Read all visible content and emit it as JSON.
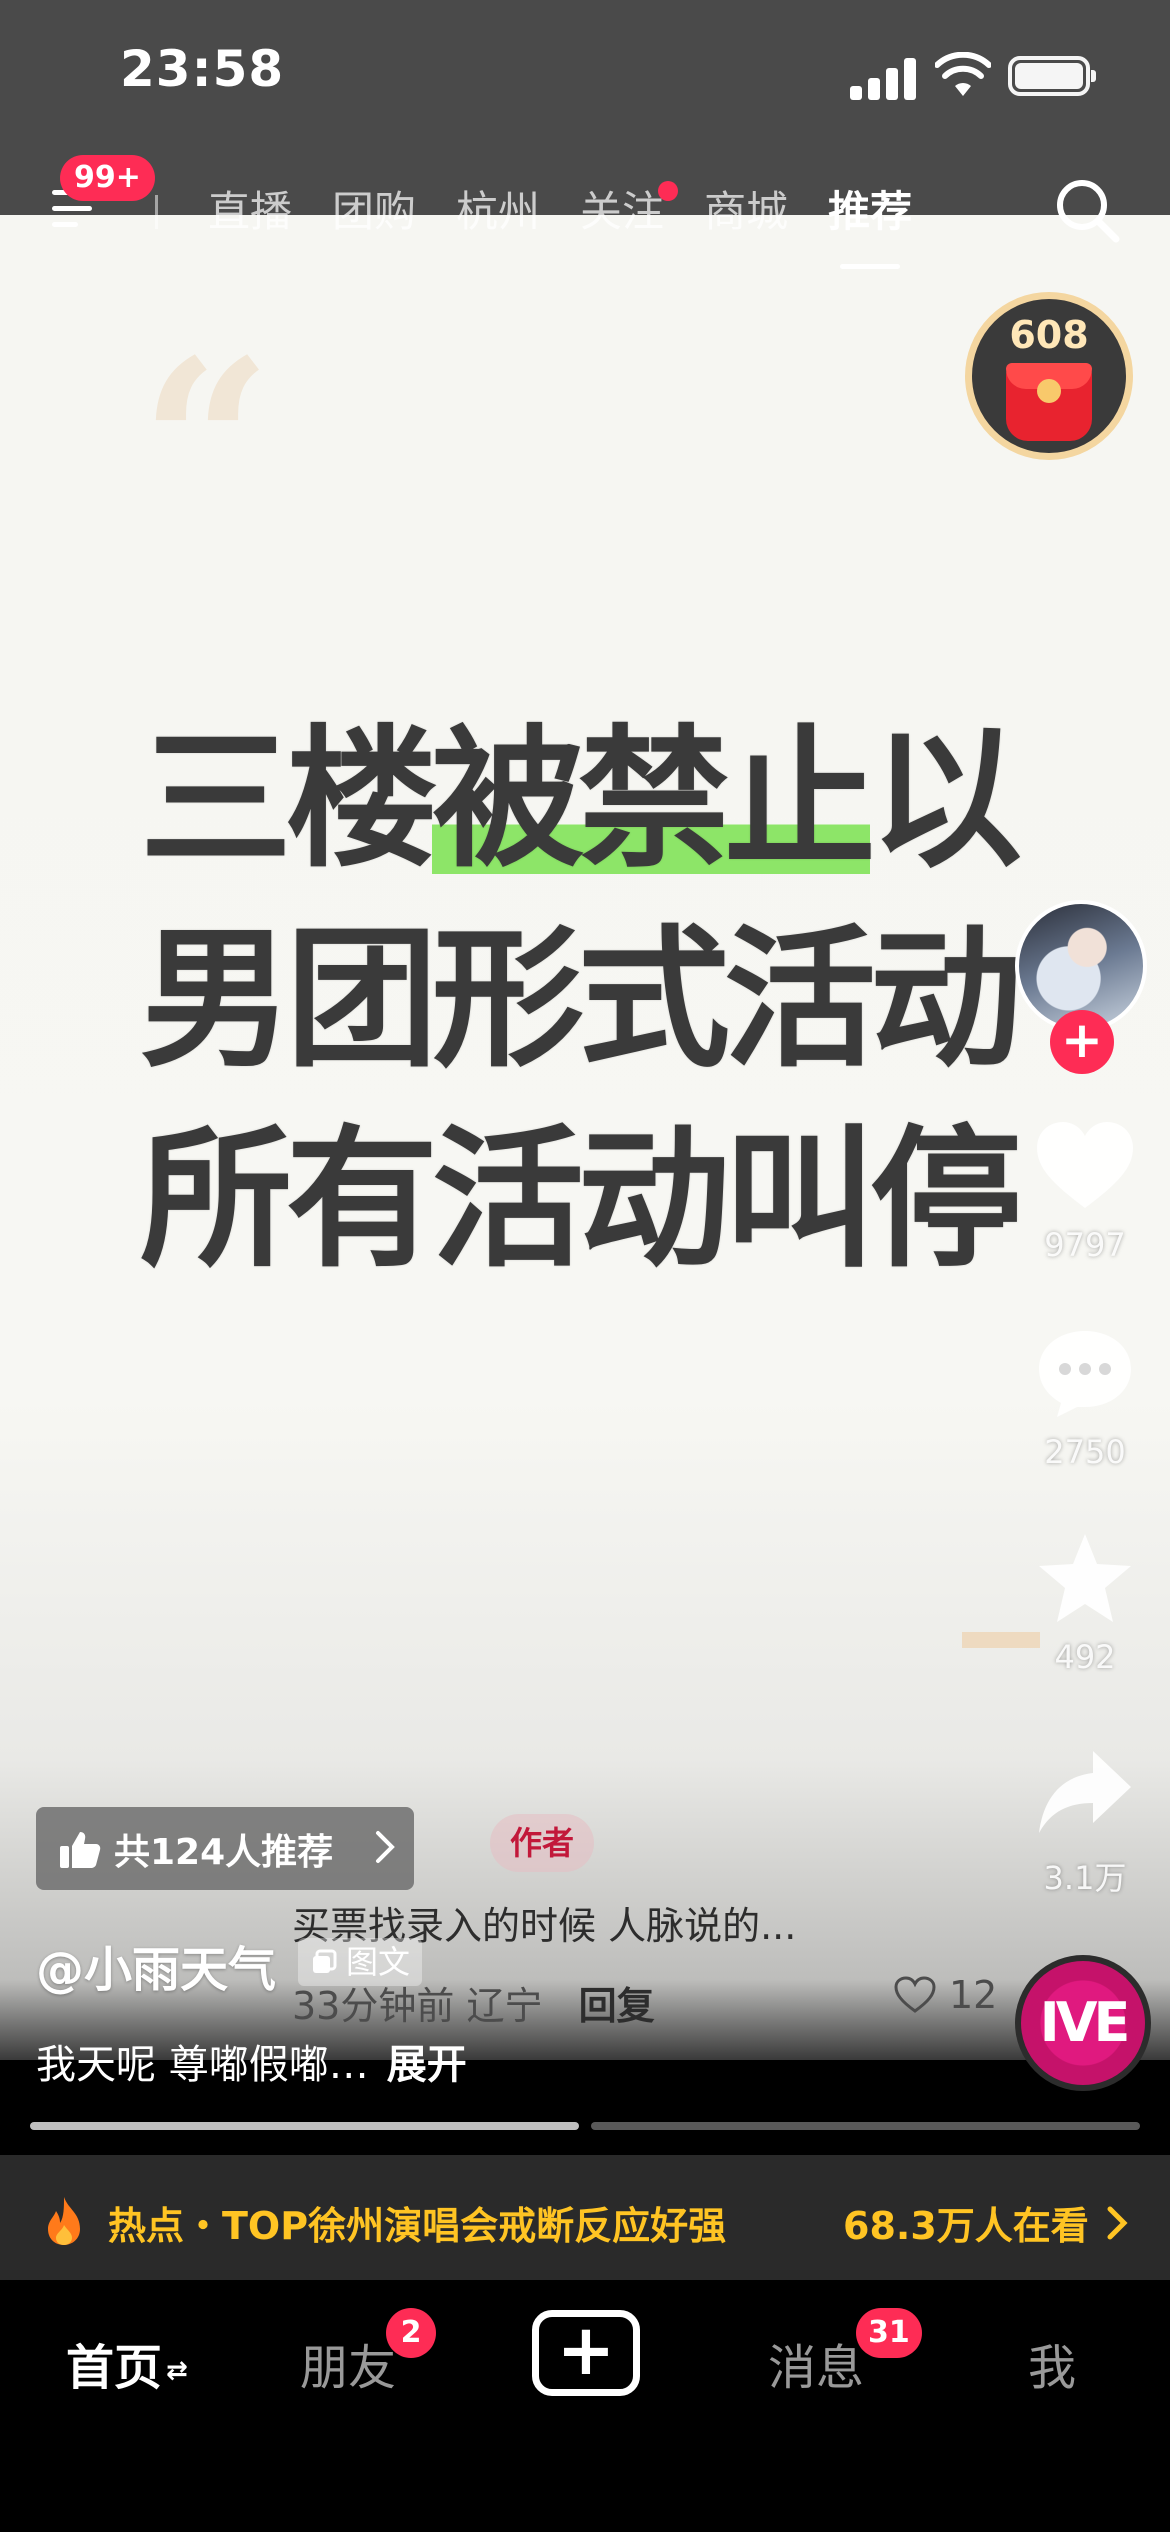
{
  "status_bar": {
    "time": "23:58"
  },
  "top_nav": {
    "menu_badge": "99+",
    "tabs": [
      {
        "label": "直播"
      },
      {
        "label": "团购"
      },
      {
        "label": "杭州"
      },
      {
        "label": "关注"
      },
      {
        "label": "商城"
      },
      {
        "label": "推荐"
      }
    ],
    "active_tab": "推荐"
  },
  "red_packet": {
    "count": "608"
  },
  "post": {
    "headline_lines": [
      {
        "pre": "三楼",
        "highlight": "被禁止",
        "post": "以"
      },
      {
        "pre": "男团形式活动",
        "highlight": "",
        "post": ""
      },
      {
        "pre": "所有活动叫停",
        "highlight": "",
        "post": ""
      }
    ],
    "highlight_color": "#8de568",
    "recommend_chip": "共124人推荐",
    "username": "@小雨天气",
    "post_type": "图文",
    "caption": "我天呢 尊嘟假嘟…",
    "caption_expand": "展开",
    "progress_fraction": 0.5
  },
  "comment": {
    "author_tag": "作者",
    "text": "买票找录入的时候 人脉说的...",
    "time": "33分钟前",
    "location": "辽宁",
    "reply_label": "回复",
    "likes": "12"
  },
  "rail": {
    "follow_symbol": "+",
    "like_count": "9797",
    "comment_count": "2750",
    "favorite_count": "492",
    "share_count": "3.1万",
    "music_disc_text": "IVE"
  },
  "hot_bar": {
    "text": "热点・TOP徐州演唱会戒断反应好强",
    "viewers": "68.3万人在看"
  },
  "tab_bar": {
    "home": "首页",
    "home_switch": "⇄",
    "friends": "朋友",
    "friends_badge": "2",
    "create": "+",
    "messages": "消息",
    "messages_badge": "31",
    "me": "我"
  },
  "colors": {
    "accent": "#fe2c55",
    "hot_text": "#ffc423"
  }
}
